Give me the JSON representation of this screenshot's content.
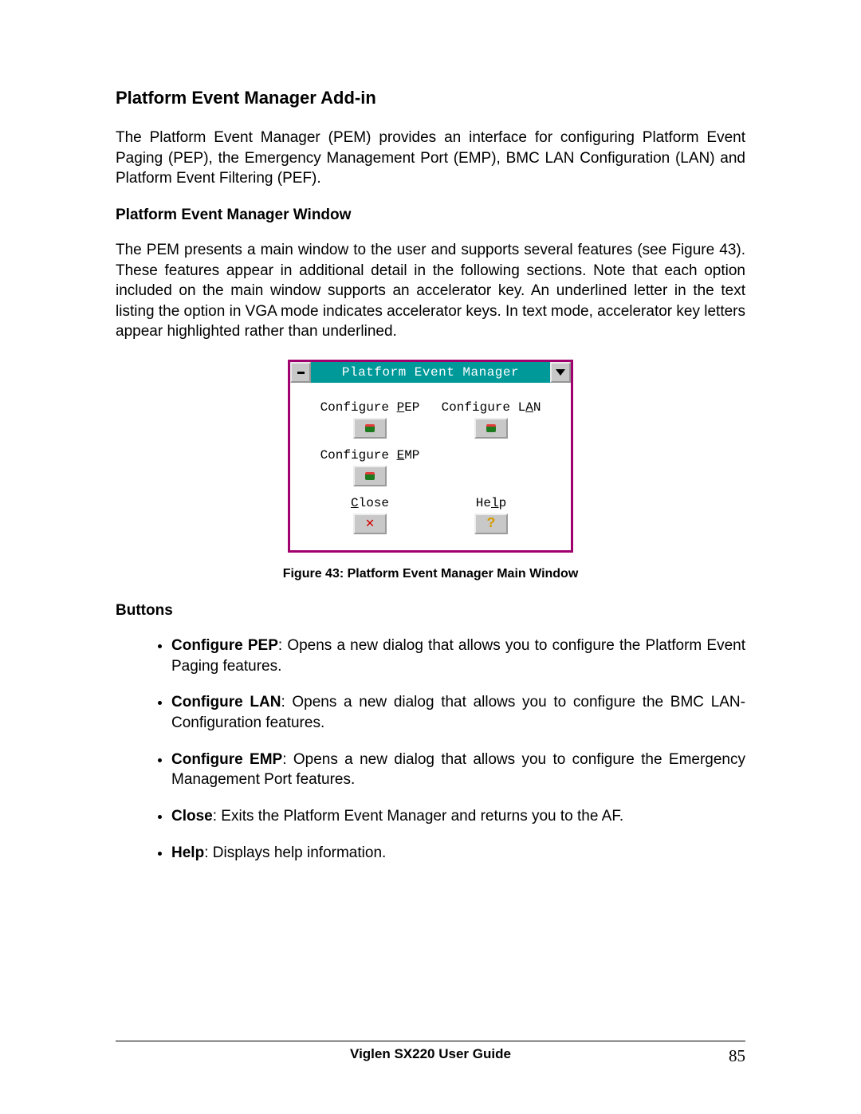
{
  "heading": "Platform Event Manager Add-in",
  "intro": "The Platform Event Manager (PEM) provides an interface for configuring Platform Event Paging (PEP), the Emergency Management Port (EMP), BMC LAN Configuration (LAN) and Platform Event Filtering (PEF).",
  "subhead1": "Platform Event Manager Window",
  "para2": "The PEM presents a main window to the user and supports several features (see Figure 43).  These features appear in additional detail in the following sections.  Note that each option included on the main window supports an accelerator key.  An underlined letter in the text listing the option in VGA mode indicates accelerator keys.  In text mode, accelerator key letters appear highlighted rather than underlined.",
  "window": {
    "title": "Platform Event Manager",
    "items": {
      "pep_pre": "Configure ",
      "pep_u": "P",
      "pep_post": "EP",
      "lan_pre": "Configure L",
      "lan_u": "A",
      "lan_post": "N",
      "emp_pre": "Configure ",
      "emp_u": "E",
      "emp_post": "MP",
      "close_u": "C",
      "close_post": "lose",
      "help_pre": "He",
      "help_u": "l",
      "help_post": "p"
    }
  },
  "caption": "Figure 43:  Platform Event Manager Main Window",
  "buttons_head": "Buttons",
  "buttons": [
    {
      "term": "Configure PEP",
      "desc": ":   Opens a new dialog that allows you to configure the Platform Event Paging features."
    },
    {
      "term": "Configure LAN",
      "desc": ":   Opens a new dialog that allows you to configure the BMC LAN-Configuration features."
    },
    {
      "term": "Configure EMP",
      "desc": ":   Opens a new dialog that allows you to configure the Emergency Management Port features."
    },
    {
      "term": "Close",
      "desc": ":  Exits the Platform Event Manager and returns you to the AF."
    },
    {
      "term": "Help",
      "desc": ":  Displays help information."
    }
  ],
  "footer": {
    "title": "Viglen SX220 User Guide",
    "page": "85"
  }
}
